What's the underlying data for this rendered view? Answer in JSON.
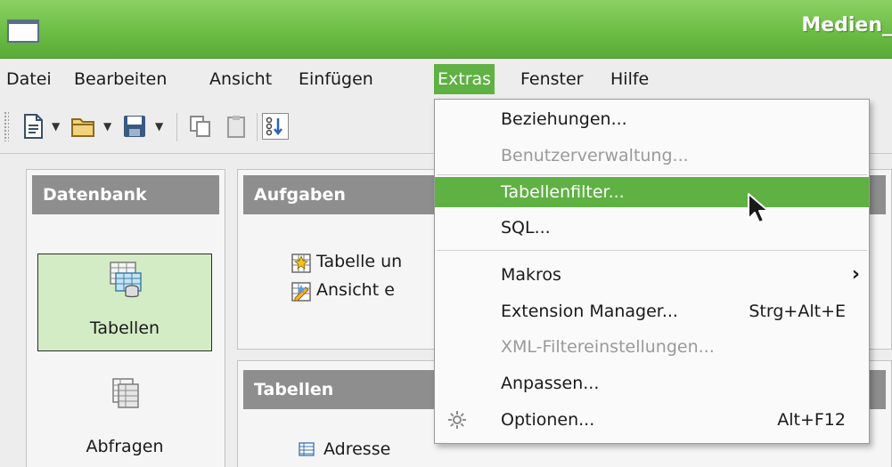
{
  "window": {
    "title": "Medien_"
  },
  "menubar": {
    "items": [
      {
        "label": "Datei",
        "key": "file"
      },
      {
        "label": "Bearbeiten",
        "key": "edit"
      },
      {
        "label": "Ansicht",
        "key": "view"
      },
      {
        "label": "Einfügen",
        "key": "insert"
      },
      {
        "label": "Extras",
        "key": "tools",
        "active": true
      },
      {
        "label": "Fenster",
        "key": "window"
      },
      {
        "label": "Hilfe",
        "key": "help"
      }
    ]
  },
  "toolbar": {
    "buttons": [
      "new-document-icon",
      "open-folder-icon",
      "save-icon",
      "copy-icon",
      "paste-icon",
      "sort-icon"
    ]
  },
  "database_panel": {
    "header": "Datenbank",
    "items": [
      {
        "label": "Tabellen",
        "icon": "tables-icon",
        "selected": true
      },
      {
        "label": "Abfragen",
        "icon": "queries-icon",
        "selected": false
      }
    ]
  },
  "tasks_panel": {
    "header": "Aufgaben",
    "items": [
      {
        "label": "Tabelle un",
        "icon": "create-table-icon"
      },
      {
        "label": "Ansicht e",
        "icon": "create-view-icon"
      }
    ]
  },
  "tables_panel": {
    "header": "Tabellen",
    "items": [
      {
        "label": "Adresse",
        "icon": "table-icon"
      }
    ]
  },
  "extras_menu": {
    "items": [
      {
        "label": "Beziehungen...",
        "enabled": true
      },
      {
        "label": "Benutzerverwaltung...",
        "enabled": false
      },
      {
        "label": "Tabellenfilter...",
        "enabled": true,
        "highlighted": true
      },
      {
        "label": "SQL...",
        "enabled": true
      },
      {
        "label": "Makros",
        "enabled": true,
        "submenu": true
      },
      {
        "label": "Extension Manager...",
        "enabled": true,
        "shortcut": "Strg+Alt+E"
      },
      {
        "label": "XML-Filtereinstellungen...",
        "enabled": false
      },
      {
        "label": "Anpassen...",
        "enabled": true
      },
      {
        "label": "Optionen...",
        "enabled": true,
        "shortcut": "Alt+F12",
        "icon": "gear-icon"
      }
    ]
  },
  "colors": {
    "accent": "#5fb143",
    "titlebar": "#6cbd45",
    "panel_header": "#8e8e8e",
    "selection": "#d4ecc6"
  }
}
